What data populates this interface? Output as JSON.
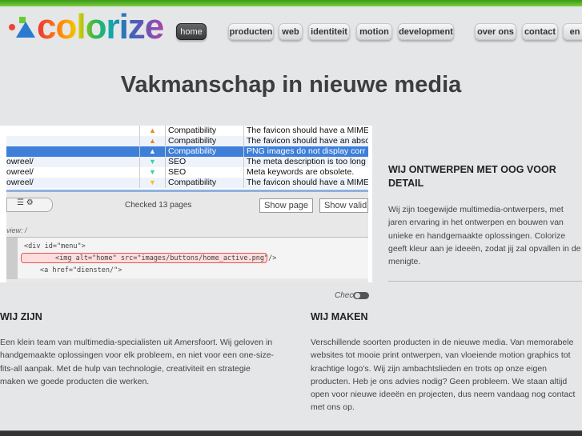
{
  "logo": {
    "text": "colorize"
  },
  "nav": [
    {
      "label": "home",
      "active": true
    },
    {
      "label": "producten"
    },
    {
      "label": "web"
    },
    {
      "label": "identiteit"
    },
    {
      "label": "motion"
    },
    {
      "label": "development"
    },
    {
      "label": "over ons"
    },
    {
      "label": "contact"
    },
    {
      "label": "en"
    }
  ],
  "hero": {
    "title": "Vakmanschap in nieuwe media"
  },
  "screenshot": {
    "rows": [
      {
        "url": "",
        "icon": "warning-orange",
        "category": "Compatibility",
        "message": "The favicon should have a MIME"
      },
      {
        "url": "",
        "icon": "warning-orange",
        "category": "Compatibility",
        "message": "The favicon should have an abso"
      },
      {
        "url": "",
        "icon": "warning-white",
        "category": "Compatibility",
        "message": "PNG images do not display corr",
        "selected": true
      },
      {
        "url": "owreel/",
        "icon": "info-green",
        "category": "SEO",
        "message": "The meta description is too long"
      },
      {
        "url": "owreel/",
        "icon": "info-green",
        "category": "SEO",
        "message": "Meta keywords are obsolete."
      },
      {
        "url": "owreel/",
        "icon": "info-yellow",
        "category": "Compatibility",
        "message": "The favicon should have a MIME"
      }
    ],
    "status": "Checked 13 pages",
    "show_page": "Show page",
    "show_valid": "Show valid",
    "view_label": "view: /",
    "code": [
      "<div id=\"menu\">",
      "<img alt=\"home\" src=\"images/buttons/home_active.png\"/>",
      "<a href=\"diensten/\">"
    ],
    "caption": "Chec"
  },
  "colors": {
    "accent": "#6cbf30",
    "selected": "#3d7fd9"
  },
  "sections": {
    "detail": {
      "title": "WIJ ONTWERPEN MET OOG VOOR DETAIL",
      "text": "Wij zijn toegewijde multimedia-ontwerpers, met jaren ervaring in het ontwerpen en bouwen van unieke en handgemaakte oplossingen. Colorize geeft kleur aan je ideeën, zodat jij zal opvallen in de menigte."
    },
    "zijn": {
      "title": "WIJ ZIJN",
      "text": "Een klein team van multimedia-specialisten uit Amersfoort. Wij geloven in handgemaakte oplossingen voor elk probleem, en niet voor een one-size-fits-all aanpak. Met de hulp van technologie, creativiteit en strategie maken we goede producten die werken."
    },
    "maken": {
      "title": "WIJ MAKEN",
      "text": "Verschillende soorten producten in de nieuwe media. Van memorabele websites tot mooie print ontwerpen, van vloeiende motion graphics tot krachtige logo's. Wij zijn ambachtslieden en trots op onze eigen producten. Heb je ons advies nodig? Geen probleem. We staan altijd open voor nieuwe ideeën en projecten, dus neem vandaag nog contact met ons op."
    }
  }
}
